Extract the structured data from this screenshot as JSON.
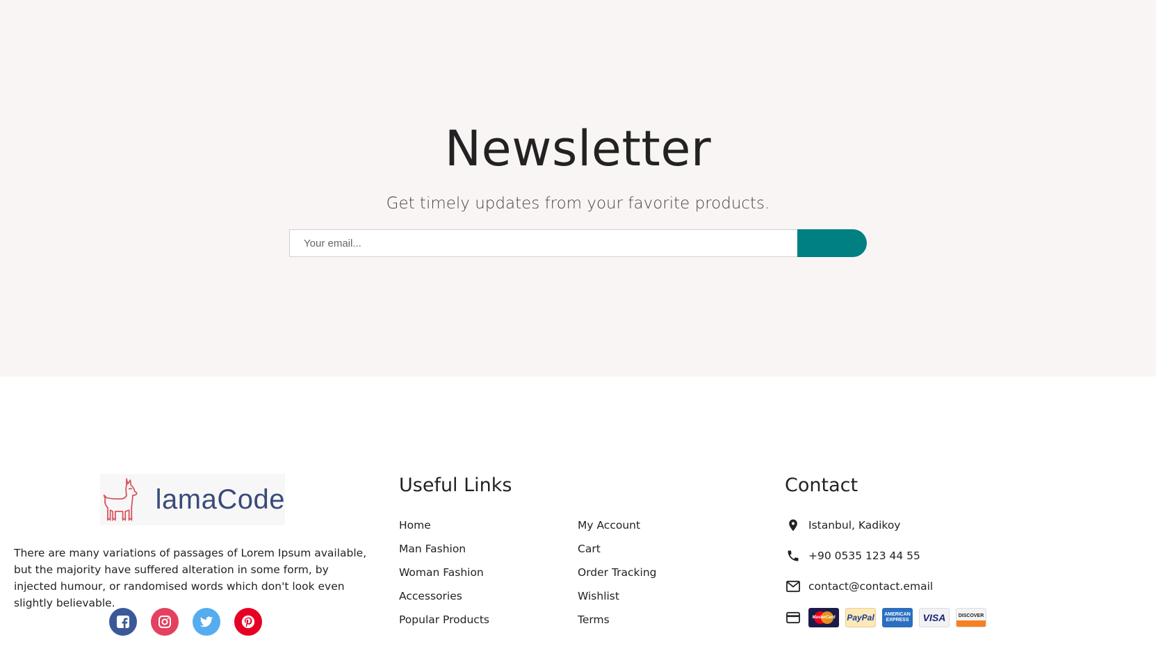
{
  "newsletter": {
    "title": "Newsletter",
    "description": "Get timely updates from your favorite products.",
    "email_placeholder": "Your email..."
  },
  "footer": {
    "logo_text": "lamaCode",
    "about": "There are many variations of passages of Lorem Ipsum available, but the majority have suffered alteration in some form, by injected humour, or randomised words which don't look even slightly believable.",
    "social_icons": [
      "facebook-icon",
      "instagram-icon",
      "twitter-icon",
      "pinterest-icon"
    ],
    "social_colors": [
      "#3b5999",
      "#e4405f",
      "#55acee",
      "#e60023"
    ],
    "useful_links_title": "Useful Links",
    "links_col1": [
      "Home",
      "Man Fashion",
      "Woman Fashion",
      "Accessories",
      "Popular Products"
    ],
    "links_col2": [
      "My Account",
      "Cart",
      "Order Tracking",
      "Wishlist",
      "Terms"
    ],
    "contact_title": "Contact",
    "address": "Istanbul, Kadikoy",
    "phone": "+90 0535 123 44 55",
    "email": "contact@contact.email",
    "payment_cards": [
      "MasterCard",
      "PayPal",
      "AMERICAN EXPRESS",
      "VISA",
      "DISCOVER"
    ],
    "accent_color": "#008080"
  }
}
